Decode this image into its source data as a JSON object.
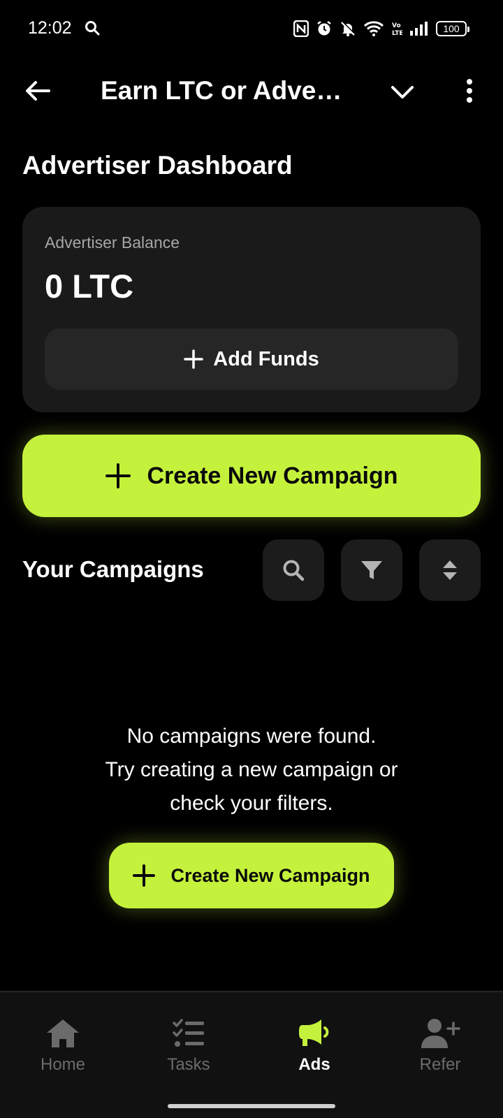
{
  "status_bar": {
    "time": "12:02",
    "battery": "100"
  },
  "app_bar": {
    "title": "Earn LTC or Adver..."
  },
  "dashboard": {
    "title": "Advertiser Dashboard"
  },
  "balance_card": {
    "label": "Advertiser Balance",
    "value": "0 LTC",
    "add_funds_label": "Add Funds"
  },
  "create_campaign": {
    "label": "Create New Campaign"
  },
  "campaigns": {
    "title": "Your Campaigns",
    "empty_lines": [
      "No campaigns were found.",
      "Try creating a new campaign or",
      "check your filters."
    ],
    "empty_button_label": "Create New Campaign"
  },
  "bottom_nav": {
    "items": [
      {
        "label": "Home",
        "icon": "home-icon",
        "active": false
      },
      {
        "label": "Tasks",
        "icon": "tasks-icon",
        "active": false
      },
      {
        "label": "Ads",
        "icon": "megaphone-icon",
        "active": true
      },
      {
        "label": "Refer",
        "icon": "add-user-icon",
        "active": false
      }
    ]
  },
  "colors": {
    "accent": "#c4f23c",
    "background": "#000000",
    "card": "#1a1a1a",
    "inactive": "#6b6b6b"
  }
}
